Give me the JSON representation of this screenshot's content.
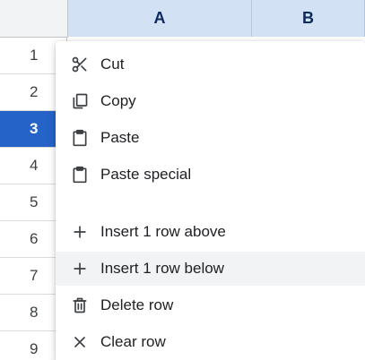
{
  "columns": [
    {
      "label": "A"
    },
    {
      "label": "B"
    }
  ],
  "rows": [
    {
      "label": "1"
    },
    {
      "label": "2"
    },
    {
      "label": "3"
    },
    {
      "label": "4"
    },
    {
      "label": "5"
    },
    {
      "label": "6"
    },
    {
      "label": "7"
    },
    {
      "label": "8"
    },
    {
      "label": "9"
    }
  ],
  "selected_row": "3",
  "context_menu": {
    "items": [
      {
        "label": "Cut",
        "icon": "scissors-icon"
      },
      {
        "label": "Copy",
        "icon": "copy-icon"
      },
      {
        "label": "Paste",
        "icon": "clipboard-icon"
      },
      {
        "label": "Paste special",
        "icon": "clipboard-icon"
      },
      {
        "label": "Insert 1 row above",
        "icon": "plus-icon"
      },
      {
        "label": "Insert 1 row below",
        "icon": "plus-icon"
      },
      {
        "label": "Delete row",
        "icon": "trash-icon"
      },
      {
        "label": "Clear row",
        "icon": "x-icon"
      }
    ]
  },
  "colors": {
    "column_header_bg": "#d3e1f5",
    "selected_row_bg": "#2563c9",
    "menu_hover_bg": "#f1f3f4"
  }
}
